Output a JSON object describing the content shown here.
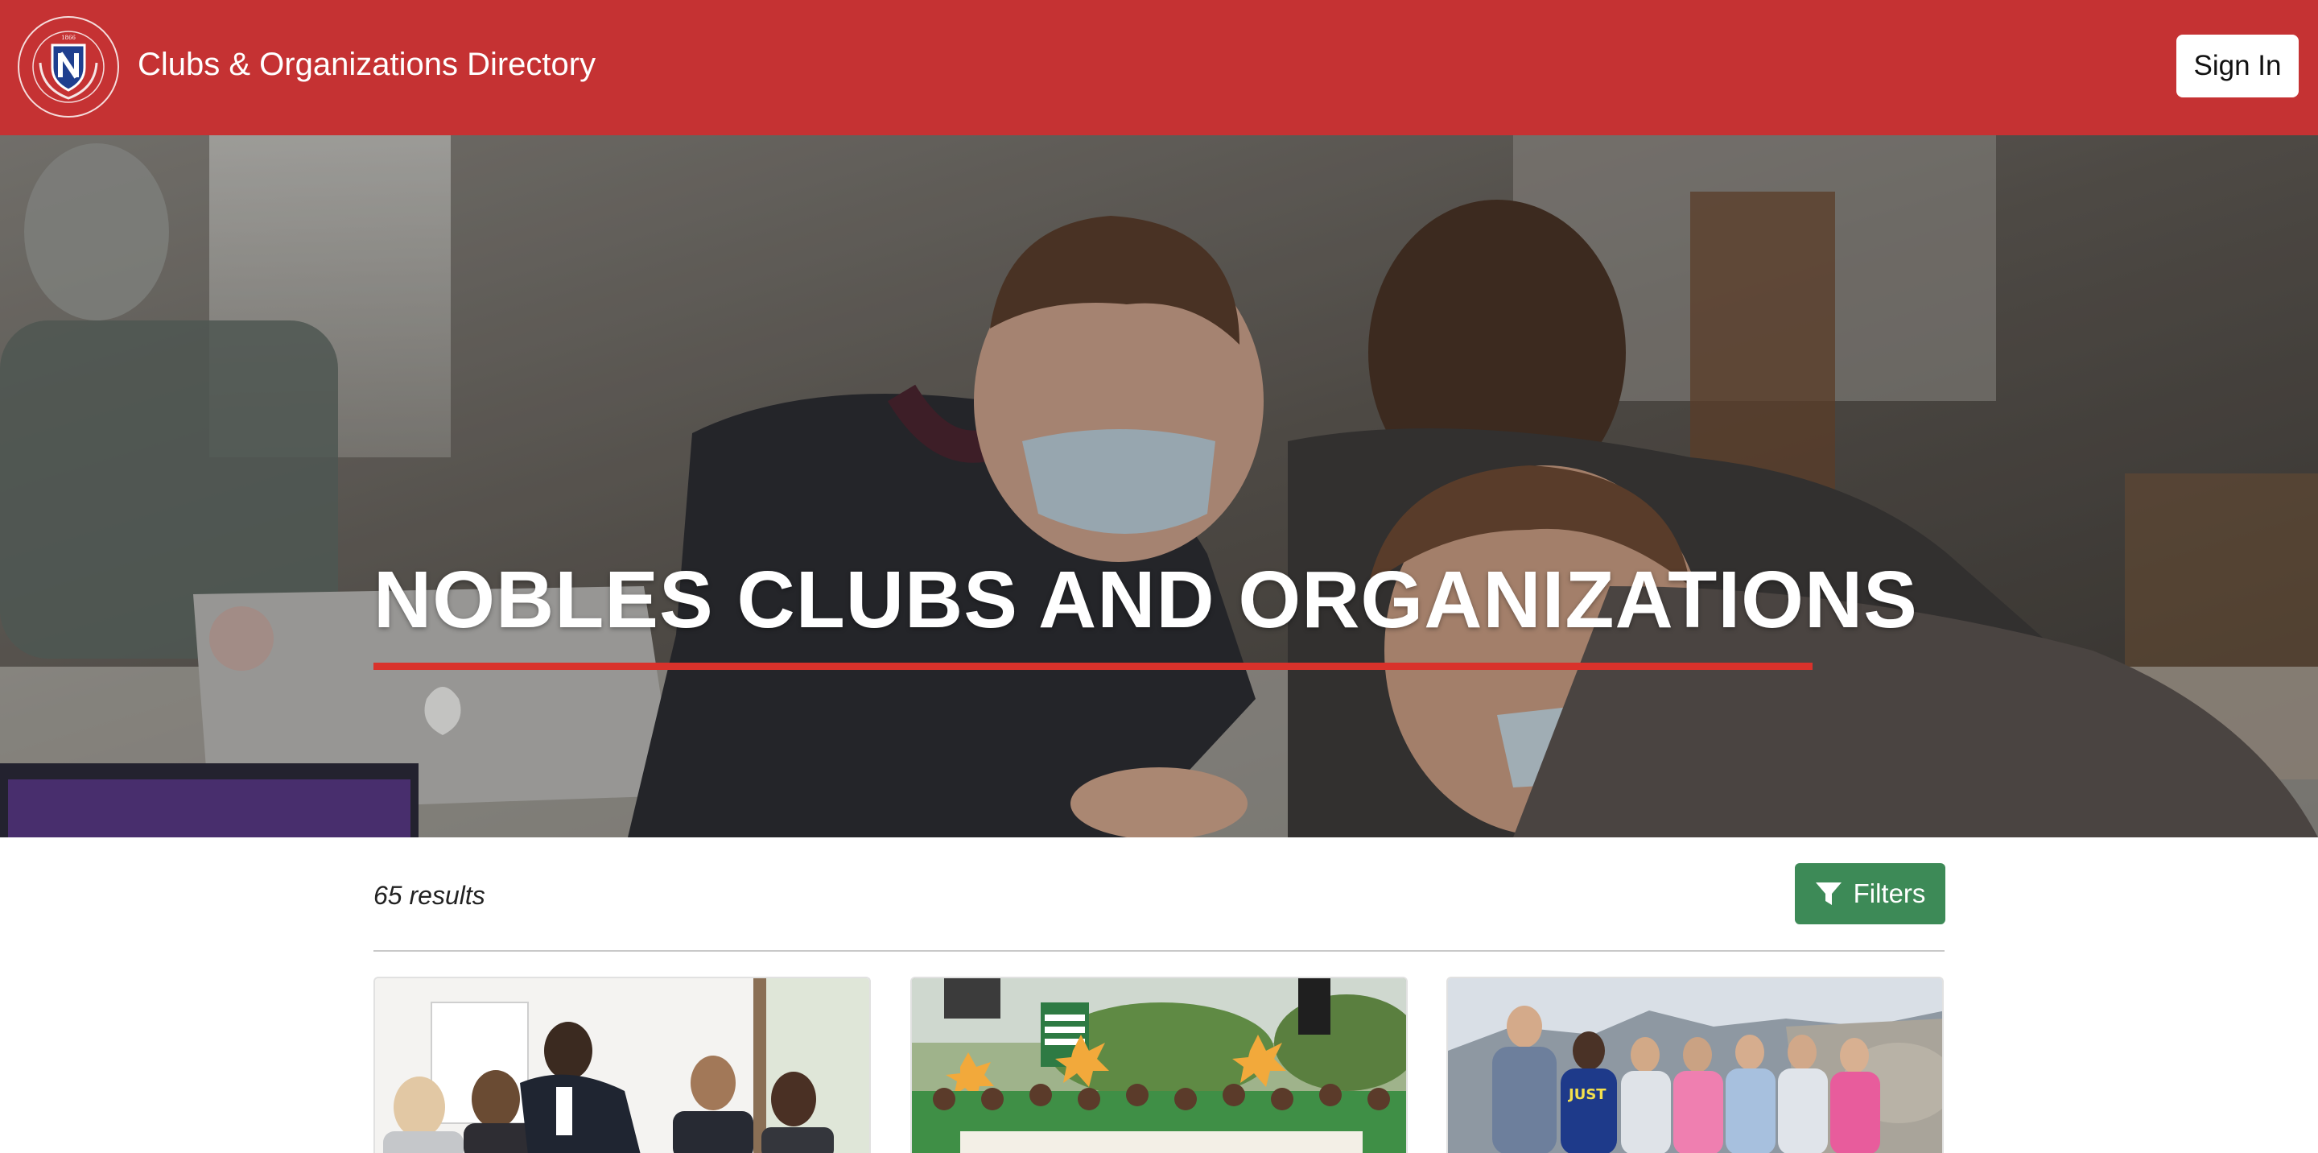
{
  "header": {
    "app_title": "Clubs & Organizations Directory",
    "logo_icon": "school-crest-icon",
    "sign_in_label": "Sign In",
    "bar_color": "#c53233"
  },
  "hero": {
    "title": "NOBLES CLUBS AND ORGANIZATIONS",
    "underline_color": "#d9322b"
  },
  "results": {
    "count_text": "65 results",
    "filters_label": "Filters",
    "filters_icon": "funnel-icon",
    "filters_color": "#3d8a57"
  },
  "cards": [
    {
      "image": "meeting-photo"
    },
    {
      "image": "rally-photo"
    },
    {
      "image": "hiking-group-photo"
    }
  ]
}
